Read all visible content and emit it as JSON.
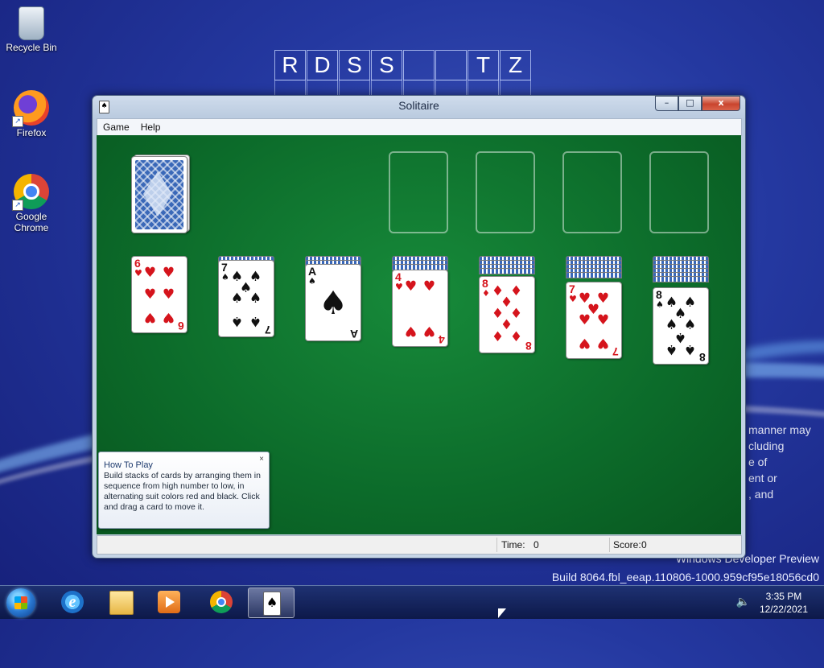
{
  "desktop": {
    "icons": [
      {
        "label": "Recycle Bin",
        "icon": "recycle-bin-icon"
      },
      {
        "label": "Firefox",
        "icon": "firefox-icon"
      },
      {
        "label": "Google Chrome",
        "icon": "chrome-icon"
      }
    ],
    "crossword_letters": [
      "R",
      "D",
      "S",
      "S",
      "",
      "",
      "T",
      "Z"
    ],
    "background_text_lines": [
      "manner may",
      "cluding",
      "e of",
      "ent or",
      ", and"
    ],
    "dev_preview": {
      "line1": "Windows Developer Preview",
      "line2": "Build 8064.fbl_eeap.110806-1000.959cf95e18056cd0"
    }
  },
  "window": {
    "title": "Solitaire",
    "controls": {
      "minimize": "–",
      "maximize": "□",
      "close": "x"
    },
    "menu": [
      "Game",
      "Help"
    ],
    "status": {
      "time_label": "Time:",
      "time_value": "0",
      "score_label": "Score:",
      "score_value": "0"
    }
  },
  "game": {
    "stock": "face-down",
    "foundations": [
      null,
      null,
      null,
      null
    ],
    "tableau": [
      {
        "hidden": 0,
        "top": {
          "rank": "6",
          "suit": "hearts",
          "symbol": "♥",
          "color": "red"
        }
      },
      {
        "hidden": 1,
        "top": {
          "rank": "7",
          "suit": "spades",
          "symbol": "♠",
          "color": "black"
        }
      },
      {
        "hidden": 2,
        "top": {
          "rank": "A",
          "suit": "spades",
          "symbol": "♠",
          "color": "black"
        }
      },
      {
        "hidden": 3,
        "top": {
          "rank": "4",
          "suit": "hearts",
          "symbol": "♥",
          "color": "red"
        }
      },
      {
        "hidden": 4,
        "top": {
          "rank": "8",
          "suit": "diamonds",
          "symbol": "♦",
          "color": "red"
        }
      },
      {
        "hidden": 5,
        "top": {
          "rank": "7",
          "suit": "hearts",
          "symbol": "♥",
          "color": "red"
        }
      },
      {
        "hidden": 6,
        "top": {
          "rank": "8",
          "suit": "spades",
          "symbol": "♠",
          "color": "black"
        }
      }
    ]
  },
  "how_to_play": {
    "title": "How To Play",
    "body": "Build stacks of cards by arranging them in sequence from high number to low, in alternating suit colors red and black. Click and drag a card to move it.",
    "close": "×"
  },
  "taskbar": {
    "apps": [
      "start-button",
      "internet-explorer-icon",
      "file-explorer-icon",
      "media-player-icon",
      "chrome-icon",
      "solitaire-icon"
    ],
    "active_app": "solitaire-icon",
    "clock_time": "3:35 PM",
    "clock_date": "12/22/2021"
  },
  "colors": {
    "felt": "#0c6b2a",
    "card_red": "#d5141c",
    "card_back": "#3a68b8"
  }
}
